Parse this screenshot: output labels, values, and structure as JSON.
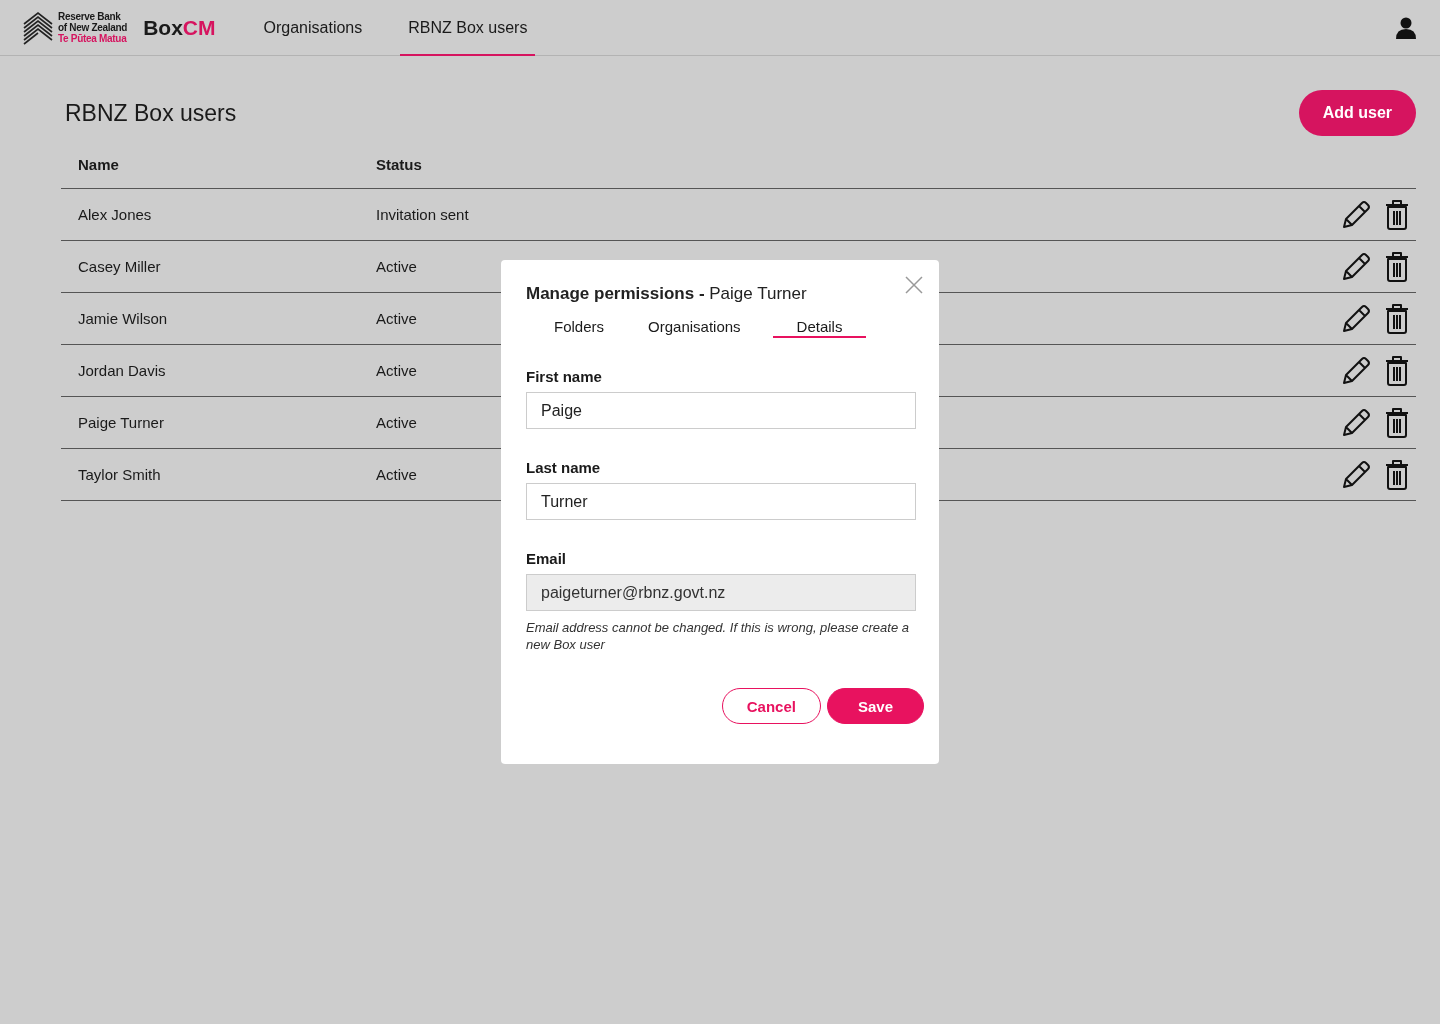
{
  "header": {
    "logo_lines": [
      "Reserve Bank",
      "of New Zealand",
      "Te Pūtea Matua"
    ],
    "brand": [
      "Box",
      "CM"
    ],
    "nav": [
      {
        "label": "Organisations",
        "selected": false
      },
      {
        "label": "RBNZ Box users",
        "selected": true
      }
    ]
  },
  "page": {
    "title": "RBNZ Box users",
    "add_button": "Add user"
  },
  "table": {
    "columns": [
      "Name",
      "Status"
    ],
    "rows": [
      {
        "name": "Alex Jones",
        "status": "Invitation sent"
      },
      {
        "name": "Casey Miller",
        "status": "Active"
      },
      {
        "name": "Jamie Wilson",
        "status": "Active"
      },
      {
        "name": "Jordan Davis",
        "status": "Active"
      },
      {
        "name": "Paige Turner",
        "status": "Active"
      },
      {
        "name": "Taylor Smith",
        "status": "Active"
      }
    ]
  },
  "dialog": {
    "title": "Manage permissions - ",
    "subject": "Paige Turner",
    "tabs": [
      {
        "label": "Folders",
        "selected": false
      },
      {
        "label": "Organisations",
        "selected": false
      },
      {
        "label": "Details",
        "selected": true
      }
    ],
    "fields": [
      {
        "label": "First name",
        "value": "Paige",
        "disabled": false
      },
      {
        "label": "Last name",
        "value": "Turner",
        "disabled": false
      },
      {
        "label": "Email",
        "value": "paigeturner@rbnz.govt.nz",
        "disabled": true
      }
    ],
    "note": "Email address cannot be changed. If this is wrong, please create a new Box user",
    "cancel": "Cancel",
    "save": "Save"
  }
}
